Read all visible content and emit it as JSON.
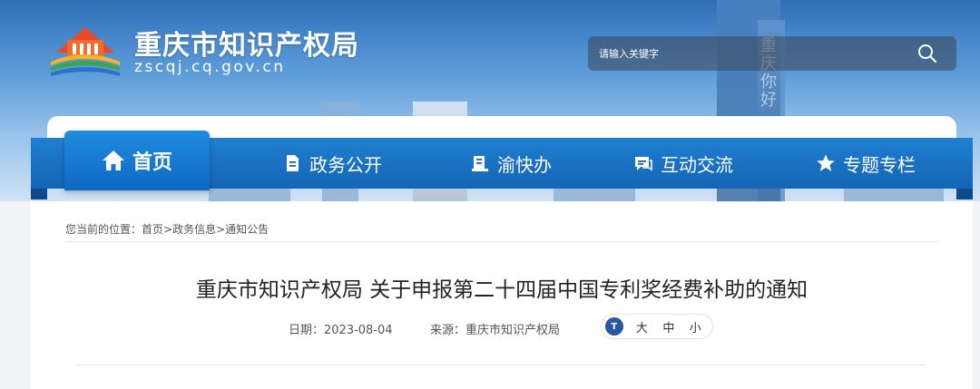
{
  "header": {
    "site_title": "重庆市知识产权局",
    "site_domain": "zscqj.cq.gov.cn",
    "search_placeholder": "请输入关键字",
    "tower_text": "重庆你好"
  },
  "nav": {
    "items": [
      {
        "label": "首页",
        "icon": "home-icon",
        "active": true
      },
      {
        "label": "政务公开",
        "icon": "document-icon"
      },
      {
        "label": "渝快办",
        "icon": "book-icon"
      },
      {
        "label": "互动交流",
        "icon": "chat-icon"
      },
      {
        "label": "专题专栏",
        "icon": "star-icon"
      }
    ]
  },
  "breadcrumb": {
    "prefix": "您当前的位置：",
    "items": [
      "首页",
      "政务信息",
      "通知公告"
    ],
    "separator": ">"
  },
  "article": {
    "title": "重庆市知识产权局 关于申报第二十四届中国专利奖经费补助的通知",
    "date_label": "日期：",
    "date": "2023-08-04",
    "source_label": "来源：",
    "source": "重庆市知识产权局"
  },
  "font_size": {
    "icon_text": "T",
    "options": [
      "大",
      "中",
      "小"
    ]
  },
  "colors": {
    "nav_blue": "#1565b5",
    "brand_dark_blue": "#0d4a8c",
    "title_text": "#222222"
  }
}
